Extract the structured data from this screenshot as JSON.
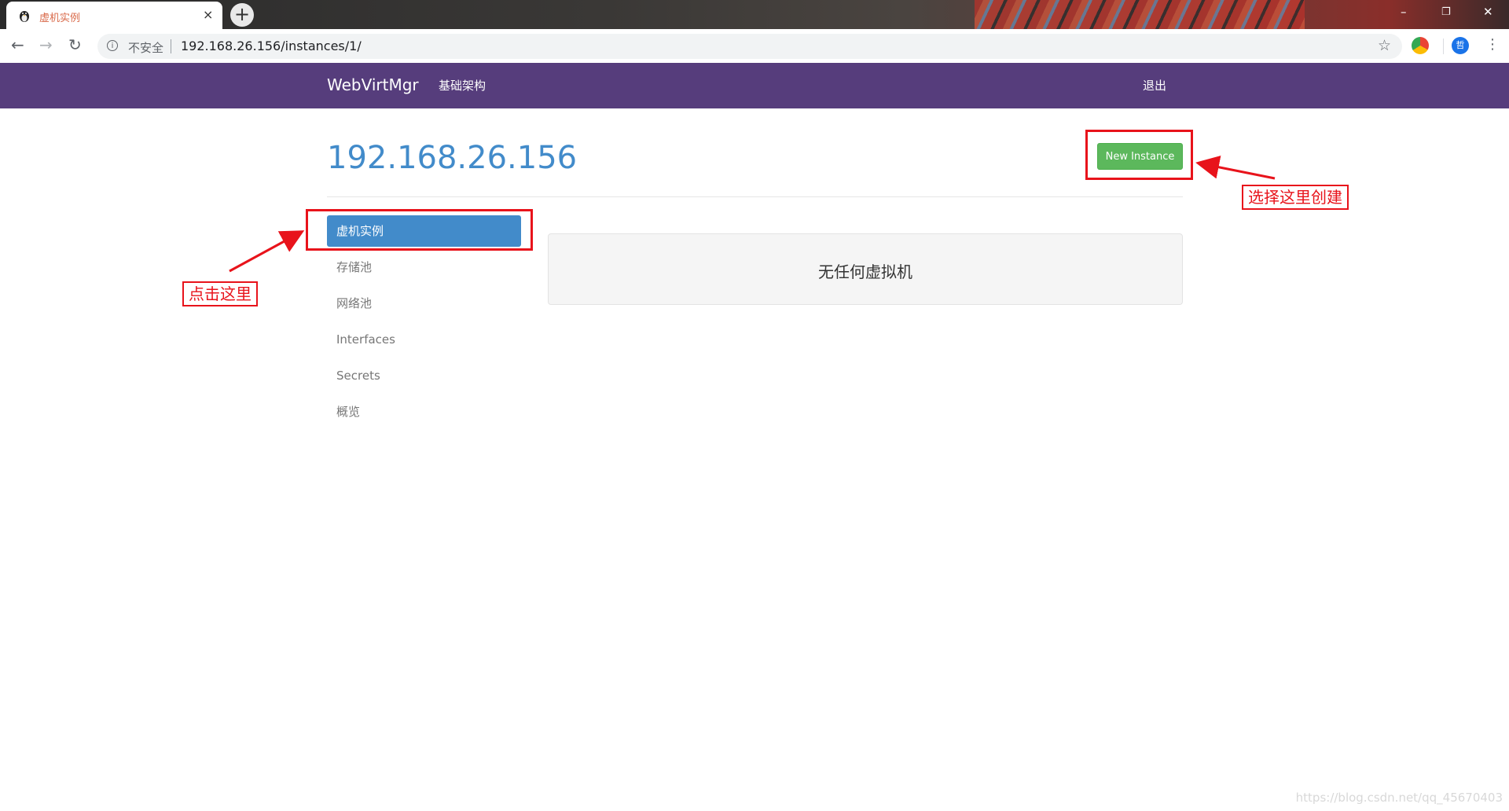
{
  "browser": {
    "tab_title": "虚机实例",
    "tab_close": "×",
    "new_tab": "+",
    "insecure_label": "不安全",
    "url": "192.168.26.156/instances/1/",
    "window_controls": [
      "–",
      "❐",
      "✕"
    ],
    "profile_initial": "哲"
  },
  "navbar": {
    "brand": "WebVirtMgr",
    "infrastructure": "基础架构",
    "logout": "退出"
  },
  "page": {
    "host_title": "192.168.26.156",
    "new_instance_button": "New Instance",
    "sidebar": {
      "items": [
        {
          "label": "虚机实例",
          "active": true
        },
        {
          "label": "存储池",
          "active": false
        },
        {
          "label": "网络池",
          "active": false
        },
        {
          "label": "Interfaces",
          "active": false
        },
        {
          "label": "Secrets",
          "active": false
        },
        {
          "label": "概览",
          "active": false
        }
      ]
    },
    "empty_message": "无任何虚拟机"
  },
  "annotations": {
    "click_here": "点击这里",
    "choose_create": "选择这里创建",
    "color": "#e8131b"
  },
  "watermark": "https://blog.csdn.net/qq_45670403"
}
